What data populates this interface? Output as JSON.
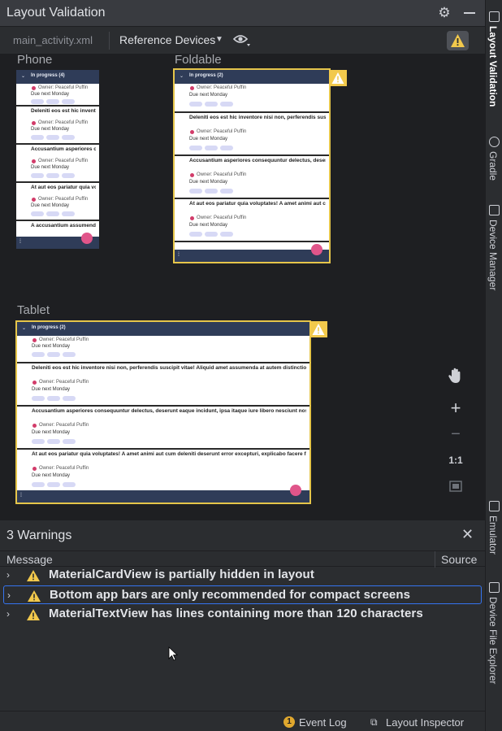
{
  "window": {
    "title": "Layout Validation"
  },
  "toolbar": {
    "file": "main_activity.xml",
    "devices_label": "Reference Devices"
  },
  "devices": {
    "phone": {
      "label": "Phone",
      "header": "In progress (4)"
    },
    "foldable": {
      "label": "Foldable",
      "header": "In progress (2)"
    },
    "tablet": {
      "label": "Tablet",
      "header": "In progress (2)"
    }
  },
  "cards": [
    {
      "title": "Deleniti eos est hic inventore nisi non, perferendis suscipit vitae! Aliquid amet assumenda at autem distinctio dolorum ducimus eius est exercitationem illo incidunt iure laborum, laudantium minima mollitia, neque nihil",
      "owner": "Owner: Peaceful Puffin",
      "due": "Due next Monday"
    },
    {
      "title": "Accusantium asperiores consequuntur delectus, deserunt eaque incidunt, ipsa itaque iure libero nesciunt nostrum optio pariatur, quas reiciendis temporibus. Ad dolor doloremque maiores mollitia sit. Consectetur",
      "owner": "Owner: Peaceful Puffin",
      "due": "Due next Monday"
    },
    {
      "title": "At aut eos pariatur quia voluptates! A amet animi aut cum deleniti deserunt error excepturi, explicabo facere fuga maxime minus nam natus nemo nihil numquam optio perspiciatis quisquam repellendus sequi,",
      "owner": "Owner: Peaceful Puffin",
      "due": "Due next Monday"
    },
    {
      "title": "A accusantium assumenda ab aut ex autem blanditiis",
      "owner": "Owner: Peaceful Puffin",
      "due": "Due next Monday"
    }
  ],
  "warnings": {
    "count_label": "3 Warnings",
    "col_message": "Message",
    "col_source": "Source",
    "items": [
      "MaterialCardView is partially hidden in layout",
      "Bottom app bars are only recommended for compact screens",
      "MaterialTextView has lines containing more than 120 characters"
    ]
  },
  "status": {
    "event_log": "Event Log",
    "event_count": "1",
    "layout_inspector": "Layout Inspector"
  },
  "side_tabs": [
    "Layout Validation",
    "Gradle",
    "Device Manager",
    "Emulator",
    "Device File Explorer"
  ],
  "zoom_tools": {
    "fit": "1:1"
  },
  "colors": {
    "warning": "#f2c94c",
    "app_bar": "#2f3c58",
    "fab": "#e0558a"
  }
}
